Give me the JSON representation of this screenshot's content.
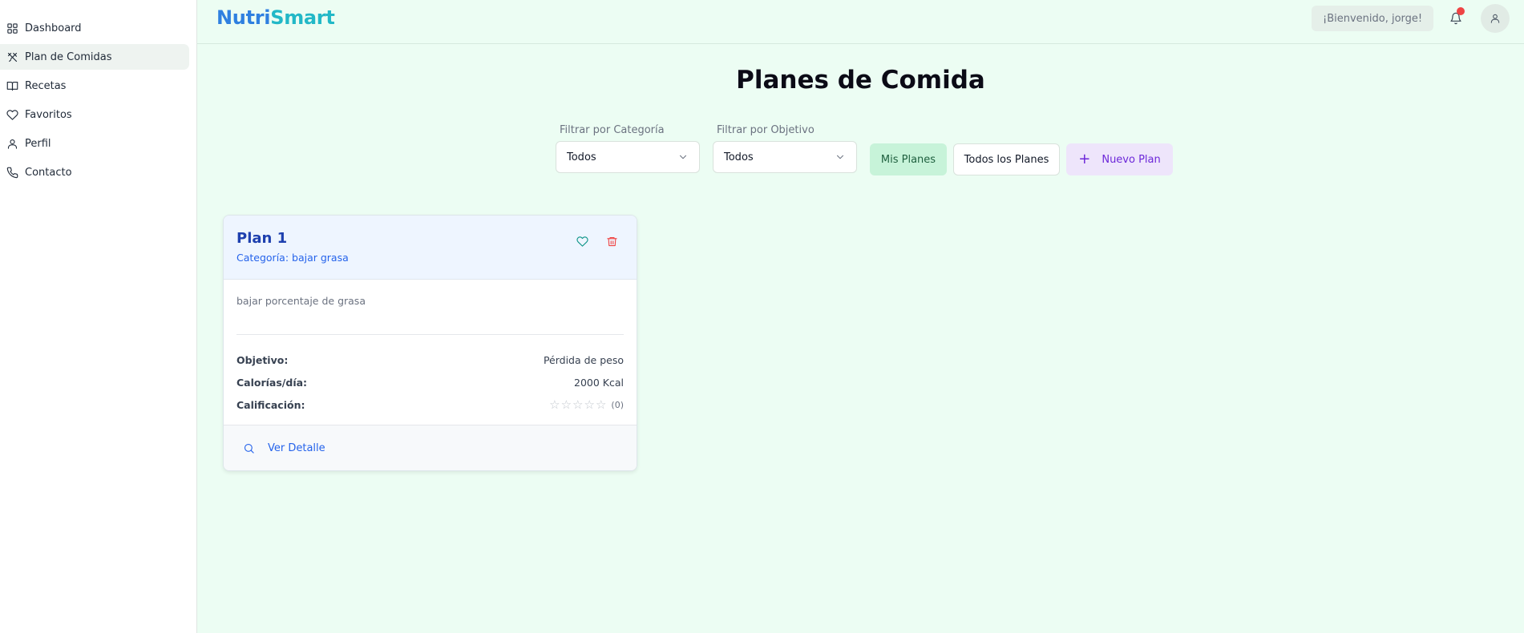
{
  "sidebar": {
    "items": [
      {
        "label": "Dashboard",
        "icon": "grid-icon"
      },
      {
        "label": "Plan de Comidas",
        "icon": "utensils-icon",
        "active": true
      },
      {
        "label": "Recetas",
        "icon": "book-icon"
      },
      {
        "label": "Favoritos",
        "icon": "heart-icon"
      },
      {
        "label": "Perfil",
        "icon": "user-icon"
      },
      {
        "label": "Contacto",
        "icon": "phone-icon"
      }
    ]
  },
  "header": {
    "logo_part1": "Nutri",
    "logo_part2": "Smart",
    "welcome": "¡Bienvenido, jorge!",
    "notification_icon": "bell-icon",
    "profile_icon": "user-icon"
  },
  "main": {
    "title": "Planes de Comida",
    "filters": {
      "category_label": "Filtrar por Categoría",
      "category_value": "Todos",
      "objective_label": "Filtrar por Objetivo",
      "objective_value": "Todos"
    },
    "buttons": {
      "my_plans": "Mis Planes",
      "all_plans": "Todos los Planes",
      "new_plan_icon": "+",
      "new_plan": "Nuevo Plan"
    },
    "plans": [
      {
        "title": "Plan 1",
        "category": "Categoría: bajar grasa",
        "description": "bajar porcentaje de grasa",
        "objective_label": "Objetivo:",
        "objective_value": "Pérdida de peso",
        "calories_label": "Calorías/día:",
        "calories_value": "2000 Kcal",
        "rating_label": "Calificación:",
        "rating_stars": 0,
        "rating_max": 5,
        "rating_count": "(0)",
        "detail_link": "Ver Detalle"
      }
    ]
  },
  "colors": {
    "background": "#ecfdf3",
    "logo_blue": "#2f80e0",
    "logo_teal": "#22b8c7",
    "accent_green": "#c7f3d9",
    "accent_purple": "#eee5fb",
    "card_header": "#eef5ff",
    "delete_red": "#ef4444",
    "notification_dot": "#ef4444"
  }
}
